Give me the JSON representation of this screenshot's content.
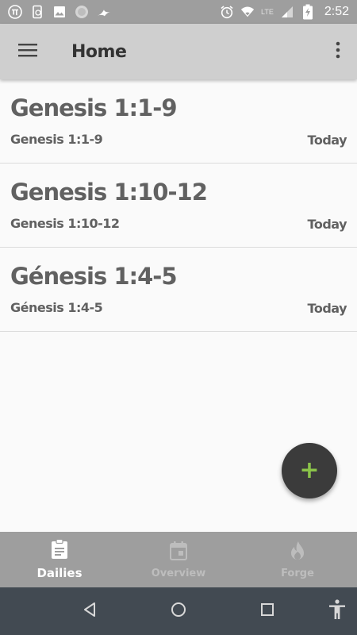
{
  "status_bar": {
    "time": "2:52",
    "network_label": "LTE",
    "left_icons": [
      "pi-icon",
      "phone-sync-icon",
      "image-icon",
      "circle-app-icon",
      "bird-app-icon"
    ],
    "right_icons": [
      "alarm-icon",
      "wifi-icon",
      "signal-icon",
      "battery-charging-icon"
    ]
  },
  "app_bar": {
    "title": "Home",
    "menu_icon": "hamburger-menu-icon",
    "overflow_icon": "more-vert-icon"
  },
  "dailies": [
    {
      "title": "Genesis 1:1-9",
      "subtitle": "Genesis 1:1-9",
      "date": "Today"
    },
    {
      "title": "Genesis 1:10-12",
      "subtitle": "Genesis 1:10-12",
      "date": "Today"
    },
    {
      "title": "Génesis 1:4-5",
      "subtitle": "Génesis 1:4-5",
      "date": "Today"
    }
  ],
  "fab": {
    "icon": "add-icon",
    "symbol": "+"
  },
  "bottom_nav": {
    "items": [
      {
        "label": "Dailies",
        "icon": "clipboard-icon",
        "active": true
      },
      {
        "label": "Overview",
        "icon": "calendar-icon",
        "active": false
      },
      {
        "label": "Forge",
        "icon": "flame-icon",
        "active": false
      }
    ]
  },
  "system_nav": {
    "icons": [
      "back-icon",
      "home-icon",
      "recents-icon",
      "accessibility-icon"
    ]
  },
  "colors": {
    "status_bar": "#9e9e9e",
    "app_bar": "#cfcfcf",
    "list_background": "#fafafa",
    "text": "#616161",
    "fab_background": "#3b3b3b",
    "fab_plus": "#8bc34a",
    "bottom_nav": "#9e9e9e",
    "system_nav": "#424a52"
  }
}
